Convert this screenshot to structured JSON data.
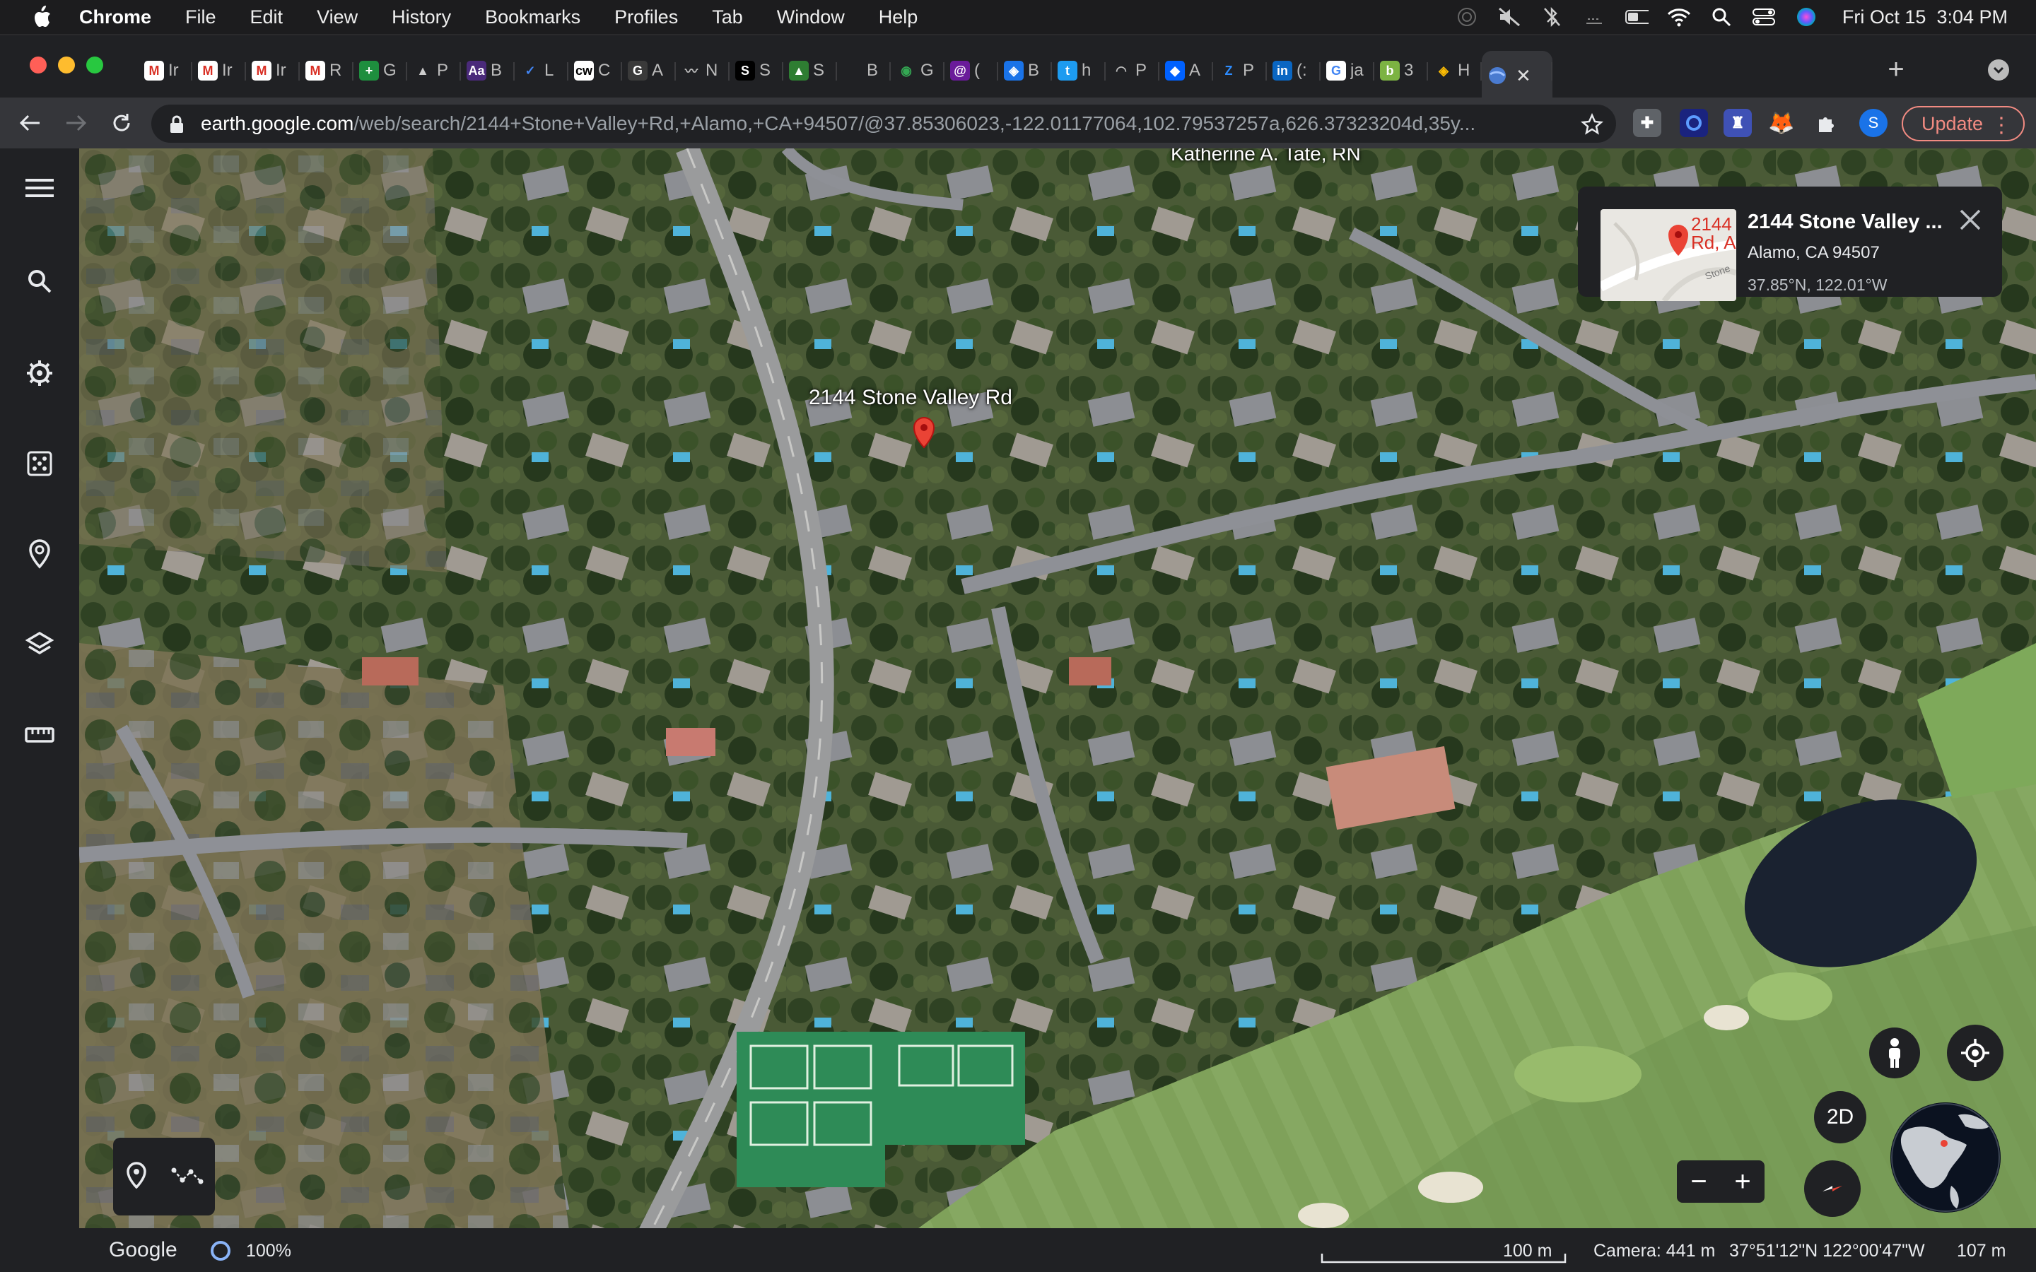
{
  "menubar": {
    "app_name": "Chrome",
    "items": [
      "File",
      "Edit",
      "View",
      "History",
      "Bookmarks",
      "Profiles",
      "Tab",
      "Window",
      "Help"
    ],
    "datetime": "Fri Oct 15  3:04 PM"
  },
  "tabs": [
    {
      "letter": "M",
      "title": "Ir",
      "color": "#ffffff",
      "fg": "#d93025"
    },
    {
      "letter": "M",
      "title": "Ir",
      "color": "#ffffff",
      "fg": "#d93025"
    },
    {
      "letter": "M",
      "title": "Ir",
      "color": "#ffffff",
      "fg": "#d93025"
    },
    {
      "letter": "M",
      "title": "R",
      "color": "#ffffff",
      "fg": "#d93025"
    },
    {
      "letter": "+",
      "title": "G",
      "color": "#1e8e3e",
      "fg": "#ffffff"
    },
    {
      "letter": "▲",
      "title": "P",
      "color": "#202124",
      "fg": "#cccccc"
    },
    {
      "letter": "Aa",
      "title": "B",
      "color": "#4a2a7a",
      "fg": "#ffffff"
    },
    {
      "letter": "✓",
      "title": "L",
      "color": "#202124",
      "fg": "#4285f4"
    },
    {
      "letter": "cw",
      "title": "C",
      "color": "#ffffff",
      "fg": "#000000"
    },
    {
      "letter": "G",
      "title": "A",
      "color": "#3a3a3a",
      "fg": "#ffffff"
    },
    {
      "letter": "〰",
      "title": "N",
      "color": "#202124",
      "fg": "#bbbbbb"
    },
    {
      "letter": "S",
      "title": "S",
      "color": "#000000",
      "fg": "#ffffff"
    },
    {
      "letter": "▲",
      "title": "S",
      "color": "#2e7d32",
      "fg": "#ffffff"
    },
    {
      "letter": "",
      "title": "B",
      "color": "#202124",
      "fg": "#ffffff"
    },
    {
      "letter": "◉",
      "title": "G",
      "color": "#202124",
      "fg": "#34a853"
    },
    {
      "letter": "@",
      "title": "(",
      "color": "#6a1b9a",
      "fg": "#ffffff"
    },
    {
      "letter": "◈",
      "title": "B",
      "color": "#1a73e8",
      "fg": "#ffffff"
    },
    {
      "letter": "t",
      "title": "h",
      "color": "#1d9bf0",
      "fg": "#ffffff"
    },
    {
      "letter": "◠",
      "title": "P",
      "color": "#202124",
      "fg": "#bbbbbb"
    },
    {
      "letter": "◆",
      "title": "A",
      "color": "#0061ff",
      "fg": "#ffffff"
    },
    {
      "letter": "Z",
      "title": "P",
      "color": "#202124",
      "fg": "#2d8cff"
    },
    {
      "letter": "in",
      "title": "(:",
      "color": "#0a66c2",
      "fg": "#ffffff"
    },
    {
      "letter": "G",
      "title": "ja",
      "color": "#ffffff",
      "fg": "#4285f4"
    },
    {
      "letter": "b",
      "title": "3",
      "color": "#7cb342",
      "fg": "#ffffff"
    },
    {
      "letter": "◈",
      "title": "H",
      "color": "#202124",
      "fg": "#fbbc04"
    }
  ],
  "active_tab": {
    "close": "✕"
  },
  "toolbar": {
    "url_host": "earth.google.com",
    "url_path": "/web/search/2144+Stone+Valley+Rd,+Alamo,+CA+94507/@37.85306023,-122.01177064,102.79537257a,626.37323204d,35y...",
    "update_label": "Update",
    "profile_letter": "S"
  },
  "map": {
    "place_label": "2144 Stone Valley Rd",
    "top_label": "Katherine A. Tate, RN"
  },
  "infocard": {
    "title": "2144 Stone Valley ...",
    "subtitle": "Alamo, CA 94507",
    "coords": "37.85°N, 122.01°W",
    "thumb_text_1": "2144",
    "thumb_text_2": "Rd, A",
    "thumb_text_3": "Stone"
  },
  "controls": {
    "mode_2d": "2D"
  },
  "status": {
    "brand": "Google",
    "loading": "100%",
    "scale": "100 m",
    "camera": "Camera: 441 m",
    "coords": "37°51'12\"N 122°00'47\"W",
    "elevation": "107 m"
  },
  "colors": {
    "accent_red": "#ea4335",
    "update_outline": "#f28b82",
    "panel_bg": "#202124"
  }
}
